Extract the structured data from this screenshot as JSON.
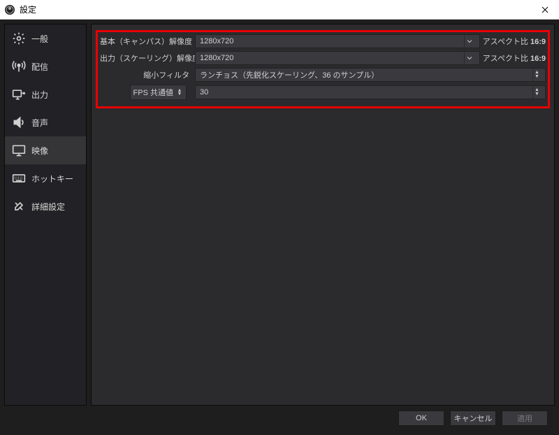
{
  "window": {
    "title": "設定",
    "icon": "obs-logo"
  },
  "sidebar": {
    "items": [
      {
        "icon": "gear-icon",
        "label": "一般"
      },
      {
        "icon": "antenna-icon",
        "label": "配信"
      },
      {
        "icon": "output-icon",
        "label": "出力"
      },
      {
        "icon": "speaker-icon",
        "label": "音声"
      },
      {
        "icon": "monitor-icon",
        "label": "映像",
        "active": true
      },
      {
        "icon": "keyboard-icon",
        "label": "ホットキー"
      },
      {
        "icon": "tools-icon",
        "label": "詳細設定"
      }
    ]
  },
  "video": {
    "base_label": "基本（キャンパス）解像度",
    "base_value": "1280x720",
    "base_aspect_label": "アスペクト比",
    "base_aspect_value": "16:9",
    "output_label": "出力（スケーリング）解像度",
    "output_value": "1280x720",
    "output_aspect_label": "アスペクト比",
    "output_aspect_value": "16:9",
    "filter_label": "縮小フィルタ",
    "filter_value": "ランチョス（先鋭化スケーリング、36 のサンプル）",
    "fps_label": "FPS 共通値",
    "fps_value": "30"
  },
  "footer": {
    "ok": "OK",
    "cancel": "キャンセル",
    "apply": "適用"
  }
}
